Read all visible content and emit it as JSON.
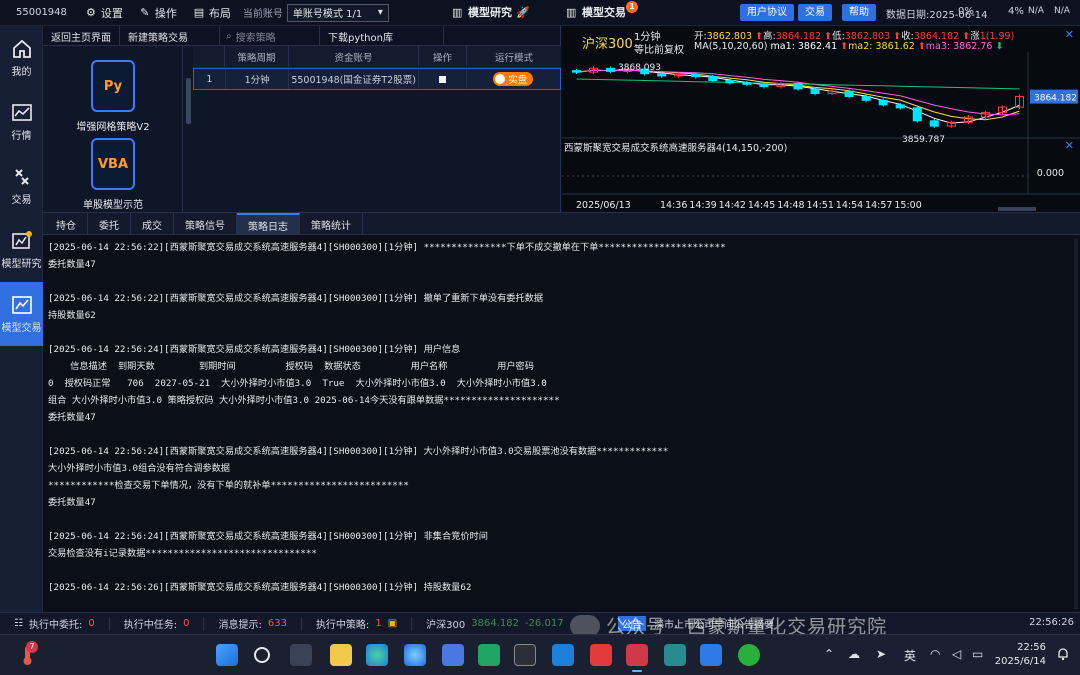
{
  "topbar": {
    "account": "55001948",
    "settings": "设置",
    "operation": "操作",
    "layout": "布局",
    "current_account_label": "当前账号",
    "account_mode": "单账号模式 1/1",
    "tab_research": "模型研究",
    "tab_trade": "模型交易",
    "trade_badge": "1",
    "user_agreement": "用户协议",
    "trade_btn": "交易",
    "help_btn": "帮助",
    "meta_text": "数据日期:2025-06-14",
    "meta_pct1": "0%",
    "meta_pct2": "4%",
    "meta_na1": "N/A",
    "meta_na2": "N/A"
  },
  "rail": [
    {
      "label": "我的",
      "icon": "home-icon"
    },
    {
      "label": "行情",
      "icon": "chart-icon"
    },
    {
      "label": "交易",
      "icon": "exchange-icon"
    },
    {
      "label": "模型研究",
      "icon": "research-icon"
    },
    {
      "label": "模型交易",
      "icon": "model-trade-icon"
    }
  ],
  "strategy": {
    "back": "返回主页界面",
    "new": "新建策略交易",
    "search_placeholder": "搜索策略",
    "download": "下载python库",
    "items": [
      {
        "badge": "Py",
        "name": "增强网格策略V2"
      },
      {
        "badge": "VBA",
        "name": "单股模型示范"
      }
    ],
    "table": {
      "headers": [
        "",
        "策略周期",
        "资金账号",
        "操作",
        "运行模式"
      ],
      "rows": [
        {
          "index": "1",
          "period": "1分钟",
          "account": "55001948(国金证券T2股票)",
          "mode": "实盘"
        }
      ]
    }
  },
  "chart": {
    "name": "沪深300",
    "period": "1分钟",
    "adjust": "等比前复权",
    "quote": {
      "open": "3862.803",
      "high": "3864.182",
      "low": "3862.803",
      "close": "3864.182",
      "change": "1(1.99)"
    },
    "quote_labels": {
      "open": "开:",
      "high": "高:",
      "low": "低:",
      "close": "收:",
      "change": "涨"
    },
    "ma_label": "MA(5,10,20,60)",
    "ma1": "ma1: 3862.41",
    "ma2": "ma2: 3861.62",
    "ma3": "ma3: 3862.76",
    "price_top": "3868.093",
    "price_low": "3859.787",
    "price_current": "3864.182",
    "indicator": "西蒙斯聚宽交易成交系统高速服务器4(14,150,-200)",
    "indicator_zero": "0.000",
    "date": "2025/06/13",
    "times": [
      "14:36",
      "14:39",
      "14:42",
      "14:45",
      "14:48",
      "14:51",
      "14:54",
      "14:57",
      "15:00"
    ],
    "colors": {
      "up": "#ff3b3b",
      "down": "#00e5ff",
      "ma1": "#ffffff",
      "ma2": "#ffd84d",
      "ma3": "#ff5ee0",
      "ma4": "#19c37d"
    }
  },
  "chart_data": {
    "type": "candlestick",
    "title": "沪深300",
    "x": [
      "14:33",
      "14:34",
      "14:35",
      "14:36",
      "14:37",
      "14:38",
      "14:39",
      "14:40",
      "14:41",
      "14:42",
      "14:43",
      "14:44",
      "14:45",
      "14:46",
      "14:47",
      "14:48",
      "14:49",
      "14:50",
      "14:51",
      "14:52",
      "14:53",
      "14:54",
      "14:55",
      "14:56",
      "14:57",
      "14:58",
      "15:00"
    ],
    "open": [
      3867.6,
      3867.4,
      3867.9,
      3867.5,
      3867.8,
      3867.2,
      3866.9,
      3867.1,
      3866.8,
      3866.3,
      3866.0,
      3865.8,
      3865.5,
      3865.9,
      3865.2,
      3864.6,
      3864.9,
      3864.2,
      3863.7,
      3863.1,
      3862.7,
      3861.0,
      3860.3,
      3860.8,
      3861.5,
      3862.1,
      3862.8
    ],
    "close": [
      3867.4,
      3867.9,
      3867.5,
      3867.8,
      3867.2,
      3866.9,
      3867.1,
      3866.8,
      3866.3,
      3866.0,
      3865.8,
      3865.5,
      3865.9,
      3865.2,
      3864.6,
      3864.9,
      3864.2,
      3863.7,
      3863.1,
      3862.7,
      3861.0,
      3860.3,
      3860.8,
      3861.5,
      3862.1,
      3862.8,
      3864.2
    ],
    "ylim": [
      3859.0,
      3869.0
    ]
  },
  "log": {
    "tabs": [
      "持仓",
      "委托",
      "成交",
      "策略信号",
      "策略日志",
      "策略统计"
    ],
    "active_tab": 4,
    "lines": [
      "[2025-06-14 22:56:22][西蒙斯聚宽交易成交系统高速服务器4][SH000300][1分钟] ***************下单不成交撤单在下单***********************",
      "委托数量47",
      "",
      "[2025-06-14 22:56:22][西蒙斯聚宽交易成交系统高速服务器4][SH000300][1分钟] 撤单了重新下单没有委托数据",
      "持股数量62",
      "",
      "[2025-06-14 22:56:24][西蒙斯聚宽交易成交系统高速服务器4][SH000300][1分钟] 用户信息",
      "    信息描述  到期天数        到期时间         授权码  数据状态         用户名称         用户密码",
      "0  授权码正常   706  2027-05-21  大小外择时小市值3.0  True  大小外择时小市值3.0  大小外择时小市值3.0",
      "组合 大小外择时小市值3.0 策略授权码 大小外择时小市值3.0 2025-06-14今天没有跟单数据*********************",
      "委托数量47",
      "",
      "[2025-06-14 22:56:24][西蒙斯聚宽交易成交系统高速服务器4][SH000300][1分钟] 大小外择时小市值3.0交易股票池没有数据*************",
      "大小外择时小市值3.0组合没有符合调参数据",
      "************检查交易下单情况，没有下单的就补单*************************",
      "委托数量47",
      "",
      "[2025-06-14 22:56:24][西蒙斯聚宽交易成交系统高速服务器4][SH000300][1分钟] 非集合竞价时间",
      "交易检查没有i记录数据*******************************",
      "",
      "[2025-06-14 22:56:26][西蒙斯聚宽交易成交系统高速服务器4][SH000300][1分钟] 持股数量62"
    ]
  },
  "status": {
    "exec_orders_label": "执行中委托:",
    "exec_orders": "0",
    "exec_tasks_label": "执行中任务:",
    "exec_tasks": "0",
    "msg_label": "消息提示:",
    "msg": "633",
    "exec_strats_label": "执行中策略:",
    "exec_strats": "1",
    "index_name": "沪深300",
    "index_value": "3864.182",
    "index_change": "-26.017",
    "tag": "公告",
    "notice": "深市上市公司早间公告摘要",
    "time": "22:56:26"
  },
  "watermark": "公众号 · 西蒙斯量化交易研究院",
  "taskbar": {
    "weather_badge": "7",
    "ime": "英",
    "time": "22:56",
    "date": "2025/6/14"
  }
}
